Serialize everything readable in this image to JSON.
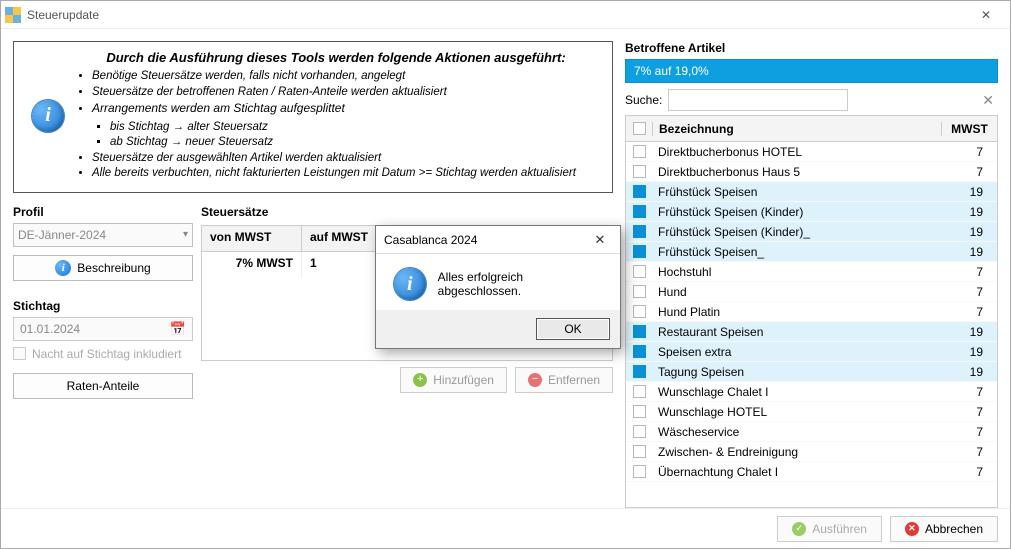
{
  "title": "Steuerupdate",
  "info": {
    "heading": "Durch die Ausführung dieses Tools werden folgende Aktionen ausgeführt:",
    "lines": [
      "Benötige Steuersätze werden, falls nicht vorhanden, angelegt",
      "Steuersätze der betroffenen Raten / Raten-Anteile werden aktualisiert",
      "Arrangements werden am Stichtag aufgesplittet",
      "bis Stichtag → alter Steuersatz",
      "ab Stichtag → neuer Steuersatz",
      "Steuersätze der ausgewählten Artikel werden aktualisiert",
      "Alle bereits verbuchten, nicht fakturierten Leistungen mit Datum >= Stichtag werden aktualisiert"
    ]
  },
  "profil": {
    "label": "Profil",
    "value": "DE-Jänner-2024",
    "btn": "Beschreibung"
  },
  "stichtag": {
    "label": "Stichtag",
    "value": "01.01.2024",
    "chk": "Nacht auf Stichtag inkludiert"
  },
  "ratenBtn": "Raten-Anteile",
  "rates": {
    "label": "Steuersätze",
    "heads": [
      "von MWST",
      "auf MWST"
    ],
    "row": [
      "7% MWST",
      "1"
    ],
    "addBtn": "Hinzufügen",
    "remBtn": "Entfernen"
  },
  "right": {
    "label": "Betroffene Artikel",
    "tab": "7% auf 19,0%",
    "searchLabel": "Suche:",
    "heads": [
      "Bezeichnung",
      "MWST"
    ],
    "rows": [
      {
        "n": "Direktbucherbonus HOTEL",
        "m": "7",
        "on": false
      },
      {
        "n": "Direktbucherbonus Haus 5",
        "m": "7",
        "on": false
      },
      {
        "n": "Frühstück Speisen",
        "m": "19",
        "on": true
      },
      {
        "n": "Frühstück Speisen (Kinder)",
        "m": "19",
        "on": true
      },
      {
        "n": "Frühstück Speisen (Kinder)_",
        "m": "19",
        "on": true
      },
      {
        "n": "Frühstück Speisen_",
        "m": "19",
        "on": true
      },
      {
        "n": "Hochstuhl",
        "m": "7",
        "on": false
      },
      {
        "n": "Hund",
        "m": "7",
        "on": false
      },
      {
        "n": "Hund Platin",
        "m": "7",
        "on": false
      },
      {
        "n": "Restaurant Speisen",
        "m": "19",
        "on": true
      },
      {
        "n": "Speisen extra",
        "m": "19",
        "on": true
      },
      {
        "n": "Tagung Speisen",
        "m": "19",
        "on": true
      },
      {
        "n": "Wunschlage Chalet I",
        "m": "7",
        "on": false
      },
      {
        "n": "Wunschlage HOTEL",
        "m": "7",
        "on": false
      },
      {
        "n": "Wäscheservice",
        "m": "7",
        "on": false
      },
      {
        "n": "Zwischen- & Endreinigung",
        "m": "7",
        "on": false
      },
      {
        "n": "Übernachtung Chalet I",
        "m": "7",
        "on": false
      }
    ]
  },
  "footer": {
    "run": "Ausführen",
    "cancel": "Abbrechen"
  },
  "modal": {
    "title": "Casablanca 2024",
    "msg": "Alles erfolgreich abgeschlossen.",
    "ok": "OK"
  }
}
